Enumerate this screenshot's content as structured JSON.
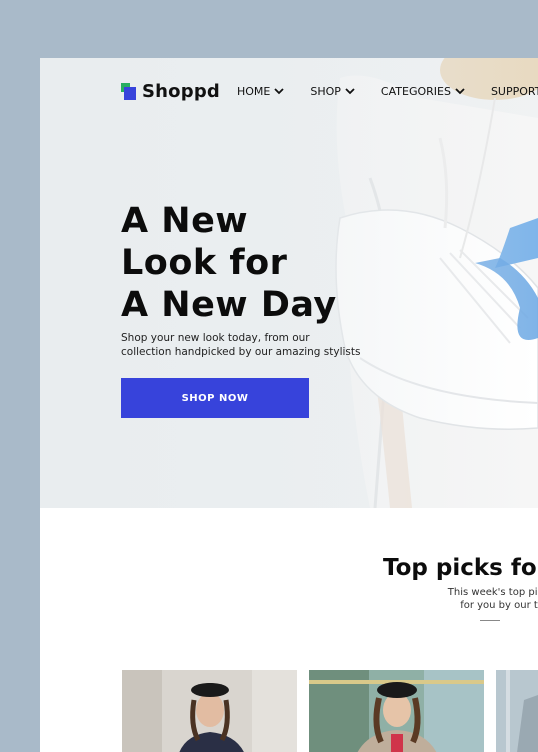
{
  "brand": {
    "name": "Shoppd"
  },
  "nav": {
    "items": [
      {
        "label": "HOME"
      },
      {
        "label": "SHOP"
      },
      {
        "label": "CATEGORIES"
      },
      {
        "label": "SUPPORT"
      }
    ]
  },
  "hero": {
    "title": "A New\nLook for\nA New Day",
    "subtitle": "Shop your new look today, from our\ncollection handpicked by our amazing stylists",
    "cta_label": "SHOP NOW"
  },
  "picks": {
    "title": "Top picks for",
    "subtitle": "This week's top picks, cu\nfor you by our team"
  },
  "colors": {
    "accent": "#3743db",
    "brand_green": "#27ae60",
    "backdrop": "#a9bac9"
  },
  "icons": [
    "logo-icon",
    "chevron-down-icon"
  ]
}
